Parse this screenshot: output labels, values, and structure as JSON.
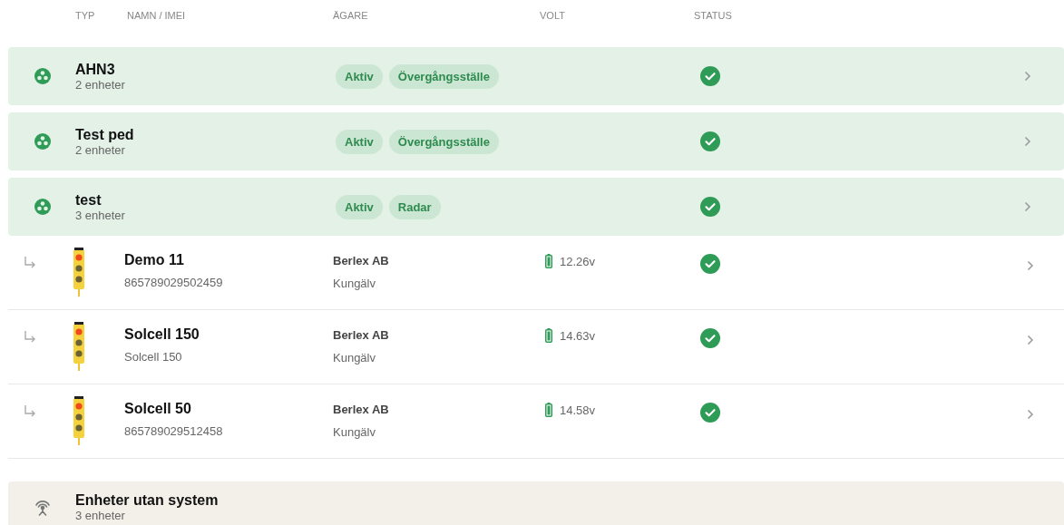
{
  "columns": [
    "TYP",
    "NAMN / IMEI",
    "ÄGARE",
    "VOLT",
    "STATUS"
  ],
  "groups": [
    {
      "kind": "system",
      "name": "AHN3",
      "count": "2 enheter",
      "tags": [
        "Aktiv",
        "Övergångsställe"
      ],
      "status_ok": true
    },
    {
      "kind": "system",
      "name": "Test ped",
      "count": "2 enheter",
      "tags": [
        "Aktiv",
        "Övergångsställe"
      ],
      "status_ok": true
    },
    {
      "kind": "system",
      "name": "test",
      "count": "3 enheter",
      "tags": [
        "Aktiv",
        "Radar"
      ],
      "status_ok": true,
      "devices": [
        {
          "name": "Demo 11",
          "imei": "865789029502459",
          "owner": "Berlex AB",
          "city": "Kungälv",
          "voltage": "12.26v",
          "status_ok": true
        },
        {
          "name": "Solcell 150",
          "imei": "Solcell 150",
          "owner": "Berlex AB",
          "city": "Kungälv",
          "voltage": "14.63v",
          "status_ok": true
        },
        {
          "name": "Solcell 50",
          "imei": "865789029512458",
          "owner": "Berlex AB",
          "city": "Kungälv",
          "voltage": "14.58v",
          "status_ok": true
        }
      ]
    },
    {
      "kind": "unassigned",
      "name": "Enheter utan system",
      "count": "3 enheter"
    }
  ]
}
